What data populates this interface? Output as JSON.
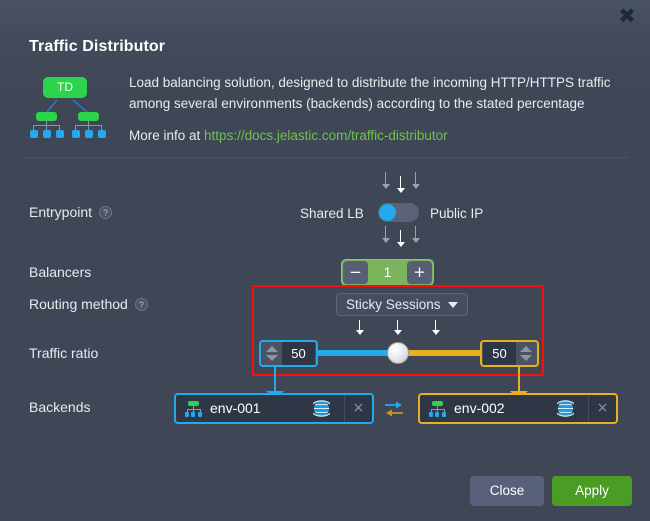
{
  "window": {
    "title": "Traffic Distributor",
    "close_icon": "close-x-icon"
  },
  "header": {
    "icon_label": "TD",
    "description_line1": "Load balancing solution, designed to distribute the incoming HTTP/HTTPS traffic",
    "description_line2": "among several environments (backends) according to the stated percentage",
    "more_info_prefix": "More info at ",
    "more_info_link": "https://docs.jelastic.com/traffic-distributor"
  },
  "rows": {
    "entrypoint": {
      "label": "Entrypoint",
      "help": "?",
      "left_option": "Shared LB",
      "right_option": "Public IP",
      "toggle_state": "left"
    },
    "balancers": {
      "label": "Balancers",
      "minus": "−",
      "value": "1",
      "plus": "+"
    },
    "routing_method": {
      "label": "Routing method",
      "help": "?",
      "selected": "Sticky Sessions"
    },
    "traffic_ratio": {
      "label": "Traffic ratio",
      "left_value": "50",
      "right_value": "50",
      "slider_percent": 50
    },
    "backends": {
      "label": "Backends",
      "items": [
        {
          "name": "env-001",
          "accent": "#25a9ed",
          "globe_icon": "globe-icon",
          "remove_icon": "×"
        },
        {
          "name": "env-002",
          "accent": "#e8b01c",
          "globe_icon": "globe-icon",
          "remove_icon": "×"
        }
      ],
      "swap_icon": "swap-arrows-icon"
    }
  },
  "footer": {
    "close_label": "Close",
    "apply_label": "Apply"
  },
  "colors": {
    "dialog_bg": "#3f4756",
    "accent_green": "#4a9c24",
    "accent_blue": "#25a9ed",
    "accent_yellow": "#e8b01c",
    "highlight_red": "#f70f0f",
    "link_green": "#6ec24f"
  }
}
